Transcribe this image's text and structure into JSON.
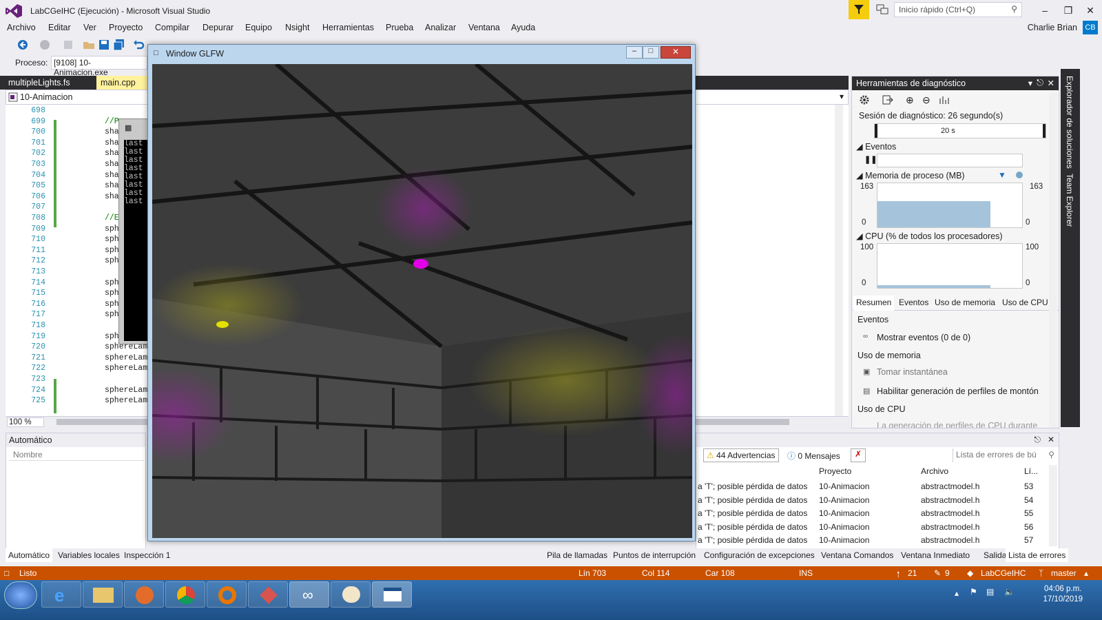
{
  "window": {
    "title": "LabCGeIHC (Ejecución) - Microsoft Visual Studio",
    "quick_launch_placeholder": "Inicio rápido (Ctrl+Q)",
    "controls": [
      "–",
      "❐",
      "✕"
    ]
  },
  "menu": [
    "Archivo",
    "Editar",
    "Ver",
    "Proyecto",
    "Compilar",
    "Depurar",
    "Equipo",
    "Nsight",
    "Herramientas",
    "Prueba",
    "Analizar",
    "Ventana",
    "Ayuda"
  ],
  "user": {
    "name": "Charlie Brian",
    "initials": "CB"
  },
  "process": {
    "label": "Proceso:",
    "value": "[9108] 10-Animacion.exe"
  },
  "editor_tabs": [
    {
      "label": "multipleLights.fs",
      "active": false
    },
    {
      "label": "main.cpp",
      "active": true
    }
  ],
  "nav": {
    "project": "10-Animacion"
  },
  "code_lines": [
    {
      "num": "698",
      "text": ""
    },
    {
      "num": "699",
      "text": "//P",
      "comment": true
    },
    {
      "num": "700",
      "text": "sha"
    },
    {
      "num": "701",
      "text": "sha"
    },
    {
      "num": "702",
      "text": "sha"
    },
    {
      "num": "703",
      "text": "sha"
    },
    {
      "num": "704",
      "text": "sha"
    },
    {
      "num": "705",
      "text": "sha"
    },
    {
      "num": "706",
      "text": "sha"
    },
    {
      "num": "707",
      "text": ""
    },
    {
      "num": "708",
      "text": "//E",
      "comment": true
    },
    {
      "num": "709",
      "text": "sph"
    },
    {
      "num": "710",
      "text": "sph"
    },
    {
      "num": "711",
      "text": "sph"
    },
    {
      "num": "712",
      "text": "sph"
    },
    {
      "num": "713",
      "text": ""
    },
    {
      "num": "714",
      "text": "sph"
    },
    {
      "num": "715",
      "text": "sph"
    },
    {
      "num": "716",
      "text": "sph"
    },
    {
      "num": "717",
      "text": "sph"
    },
    {
      "num": "718",
      "text": ""
    },
    {
      "num": "719",
      "text": "sph"
    },
    {
      "num": "720",
      "text": "sphereLam"
    },
    {
      "num": "721",
      "text": "sphereLam"
    },
    {
      "num": "722",
      "text": "sphereLam"
    },
    {
      "num": "723",
      "text": ""
    },
    {
      "num": "724",
      "text": "sphereLam"
    },
    {
      "num": "725",
      "text": "sphereLam"
    }
  ],
  "zoom": "100 %",
  "console": {
    "lines": [
      "last",
      "last",
      "last",
      "last",
      "last",
      "last",
      "last",
      "last"
    ]
  },
  "glfw": {
    "title": "Window GLFW"
  },
  "diagnostics": {
    "title": "Herramientas de diagnóstico",
    "session": "Sesión de diagnóstico: 26 segundo(s)",
    "timeline_tick": "20 s",
    "events_label": "Eventos",
    "memory_label": "Memoria de proceso (MB)",
    "memory_max": "163",
    "memory_min": "0",
    "memory_level": 0.6,
    "cpu_label": "CPU (% de todos los procesadores)",
    "cpu_max": "100",
    "cpu_min": "0",
    "tabs": [
      "Resumen",
      "Eventos",
      "Uso de memoria",
      "Uso de CPU"
    ],
    "section_events": "Eventos",
    "show_events": "Mostrar eventos (0 de 0)",
    "section_memory": "Uso de memoria",
    "take_snapshot": "Tomar instantánea",
    "heap_profiling": "Habilitar generación de perfiles de montón (a",
    "section_cpu": "Uso de CPU",
    "cpu_note": "La generación de perfiles de CPU durante la c"
  },
  "sidebar": [
    "Explorador de soluciones",
    "Team Explorer"
  ],
  "autos": {
    "title": "Automático",
    "column": "Nombre"
  },
  "errors": {
    "warnings": "44 Advertencias",
    "messages": "0 Mensajes",
    "search_placeholder": "Lista de errores de bú",
    "columns": [
      "Proyecto",
      "Archivo",
      "Lí..."
    ],
    "rows": [
      {
        "desc": "a 'T'; posible pérdida de datos",
        "project": "10-Animacion",
        "file": "abstractmodel.h",
        "line": "53"
      },
      {
        "desc": "a 'T'; posible pérdida de datos",
        "project": "10-Animacion",
        "file": "abstractmodel.h",
        "line": "54"
      },
      {
        "desc": "a 'T'; posible pérdida de datos",
        "project": "10-Animacion",
        "file": "abstractmodel.h",
        "line": "55"
      },
      {
        "desc": "a 'T'; posible pérdida de datos",
        "project": "10-Animacion",
        "file": "abstractmodel.h",
        "line": "56"
      },
      {
        "desc": "a 'T'; posible pérdida de datos",
        "project": "10-Animacion",
        "file": "abstractmodel.h",
        "line": "57"
      }
    ]
  },
  "bottom_tabs_left": [
    "Automático",
    "Variables locales",
    "Inspección 1"
  ],
  "bottom_tabs_right": [
    "Pila de llamadas",
    "Puntos de interrupción",
    "Configuración de excepciones",
    "Ventana Comandos",
    "Ventana Inmediato",
    "Salida",
    "Lista de errores"
  ],
  "status": {
    "state": "Listo",
    "line": "Lín 703",
    "col": "Col 114",
    "car": "Car 108",
    "ins": "INS",
    "up": "21",
    "pencil": "9",
    "repo": "LabCGeIHC",
    "branch": "master"
  },
  "clock": {
    "time": "04:06 p.m.",
    "date": "17/10/2019"
  },
  "colors": {
    "accent": "#007acc",
    "status": "#ca5100",
    "highlight_tab": "#fff29d"
  }
}
